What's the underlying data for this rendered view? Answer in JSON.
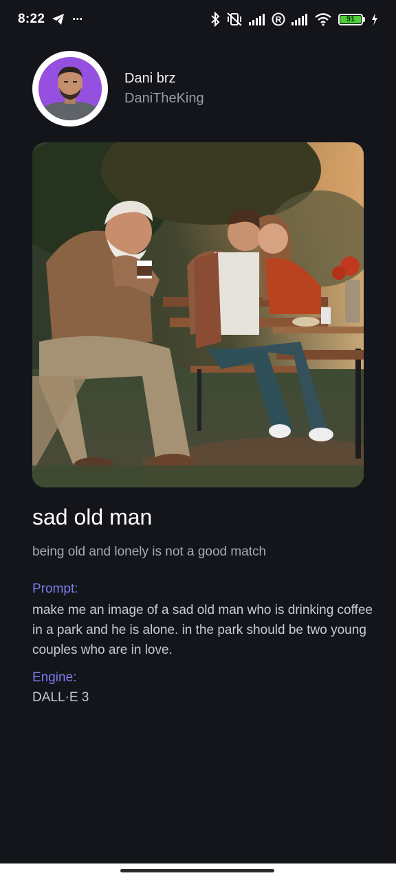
{
  "status_bar": {
    "time": "8:22",
    "overflow": "···",
    "battery_level": "91",
    "icons": [
      "telegram-icon",
      "bluetooth-icon",
      "vibrate-off-icon",
      "signal-icon",
      "registered-icon",
      "signal-icon",
      "wifi-icon",
      "battery-icon",
      "charging-icon"
    ]
  },
  "profile": {
    "name": "Dani brz",
    "handle": "DaniTheKing"
  },
  "post": {
    "title": "sad old man",
    "description": "being old and lonely is not a good match",
    "prompt_label": "Prompt:",
    "prompt": "make me an image of a sad old man who is drinking coffee in a park and he is alone. in the park should be two young couples who are in love.",
    "engine_label": "Engine:",
    "engine": "DALL·E 3"
  },
  "colors": {
    "background": "#13151b",
    "accent": "#7f7cf0",
    "battery": "#4cd137"
  }
}
